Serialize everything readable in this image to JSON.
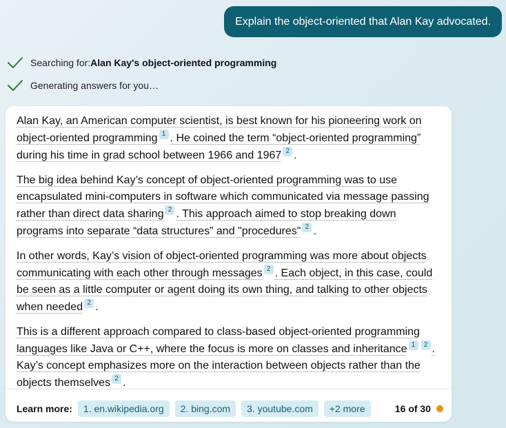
{
  "user_message": "Explain the object-oriented that Alan Kay advocated.",
  "status": {
    "searching_prefix": "Searching for: ",
    "searching_query": "Alan Kay's object-oriented programming",
    "generating": "Generating answers for you…"
  },
  "answer": {
    "p1": {
      "a": "Alan Kay, an American computer scientist, is best known for his pioneering work on object-oriented programming",
      "c1": "1",
      "b": ". He coined the term “object-oriented programming” during his time in grad school between 1966 and 1967",
      "c2": "2",
      "end": "."
    },
    "p2": {
      "a": "The big idea behind Kay’s concept of object-oriented programming was to use encapsulated mini-computers in software which communicated via message passing rather than direct data sharing",
      "c1": "2",
      "b": ". This approach aimed to stop breaking down programs into separate “data structures” and \"procedures\"",
      "c2": "2",
      "end": "."
    },
    "p3": {
      "a": "In other words, Kay’s vision of object-oriented programming was more about objects communicating with each other through messages",
      "c1": "2",
      "b": ". Each object, in this case, could be seen as a little computer or agent doing its own thing, and talking to other objects when needed",
      "c2": "2",
      "end": "."
    },
    "p4": {
      "a": "This is a different approach compared to class-based object-oriented programming languages like Java or C++, where the focus is more on classes and inheritance",
      "c1": "1",
      "c2": "2",
      "b": ". Kay’s concept emphasizes more on the interaction between objects rather than the objects themselves",
      "c3": "2",
      "end": "."
    }
  },
  "learn_more": {
    "label": "Learn more:",
    "sources": [
      "1. en.wikipedia.org",
      "2. bing.com",
      "3. youtube.com",
      "+2 more"
    ]
  },
  "counter": {
    "text": "16 of 30",
    "dot_color": "#f0900f"
  },
  "colors": {
    "accent": "#0f5f73",
    "chip_bg": "#d6ecf3",
    "check": "#2e7d32"
  }
}
